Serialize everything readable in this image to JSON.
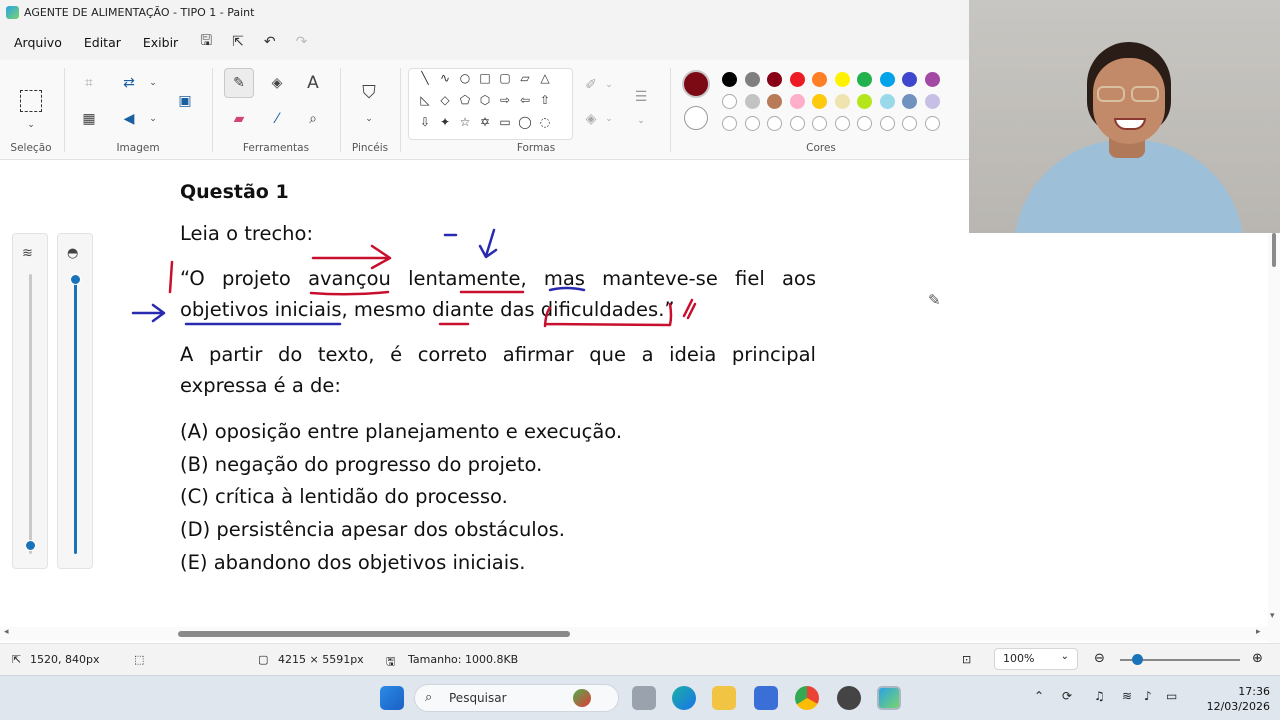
{
  "window": {
    "title": "AGENTE DE ALIMENTAÇÃO - TIPO 1 - Paint"
  },
  "menu": {
    "items": [
      "Arquivo",
      "Editar",
      "Exibir"
    ]
  },
  "ribbon": {
    "groups": {
      "selection": "Seleção",
      "image": "Imagem",
      "tools": "Ferramentas",
      "brushes": "Pincéis",
      "shapes": "Formas",
      "colors": "Cores"
    },
    "colors": {
      "current_primary": "#7b0a14",
      "current_secondary": "#ffffff",
      "row1": [
        "#000000",
        "#7f7f7f",
        "#880015",
        "#ed1c24",
        "#ff7f27",
        "#fff200",
        "#22b14c",
        "#00a2e8",
        "#3f48cc",
        "#a349a4"
      ],
      "row2": [
        "#ffffff",
        "#c3c3c3",
        "#b97a57",
        "#ffaec9",
        "#ffc90e",
        "#efe4b0",
        "#b5e61d",
        "#99d9ea",
        "#7092be",
        "#c8bfe7"
      ]
    }
  },
  "document": {
    "question_title": "Questão 1",
    "intro": "Leia o trecho:",
    "quote_line1": [
      "“O",
      "projeto",
      "avançou",
      "lentamente,",
      "mas",
      "manteve-se",
      "fiel",
      "aos"
    ],
    "quote_line2": "objetivos iniciais, mesmo diante das dificuldades.”",
    "prompt_line1": [
      "A",
      "partir",
      "do",
      "texto,",
      "é",
      "correto",
      "afirmar",
      "que",
      "a",
      "ideia",
      "principal"
    ],
    "prompt_line2": "expressa é a de:",
    "options": [
      "(A) oposição entre planejamento e execução.",
      "(B) negação do progresso do projeto.",
      "(C) crítica à lentidão do processo.",
      "(D) persistência apesar dos obstáculos.",
      "(E) abandono dos objetivos iniciais."
    ]
  },
  "statusbar": {
    "cursor_pos": "1520, 840px",
    "canvas_size": "4215 × 5591px",
    "file_size": "Tamanho: 1000.8KB",
    "zoom": "100%"
  },
  "taskbar": {
    "search_placeholder": "Pesquisar",
    "time": "17:36",
    "date": "12/03/2026"
  },
  "icons": {
    "brush_slider": "brush-size-icon",
    "opacity_slider": "opacity-icon"
  }
}
